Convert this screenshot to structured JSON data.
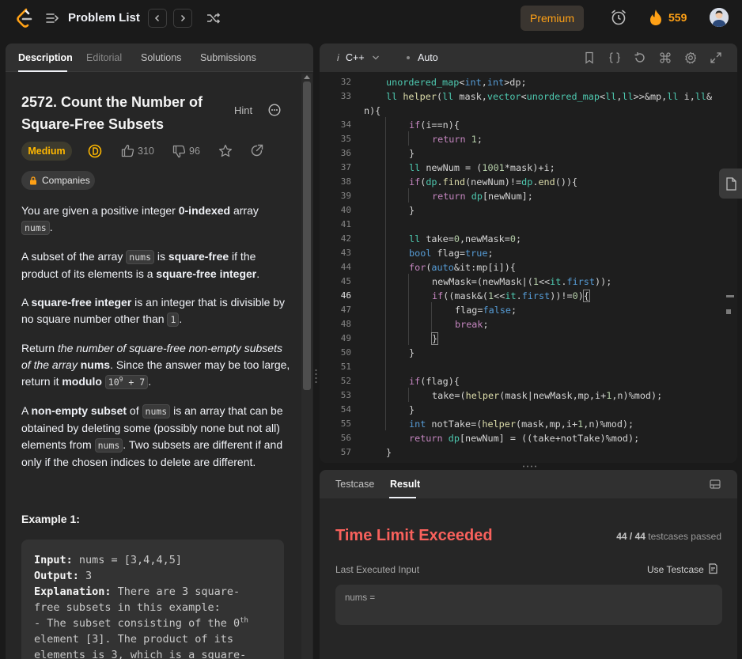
{
  "topbar": {
    "title": "Problem List",
    "premium": "Premium",
    "streak": "559"
  },
  "left_tabs": [
    "Description",
    "Editorial",
    "Solutions",
    "Submissions"
  ],
  "problem": {
    "title": "2572. Count the Number of Square-Free Subsets",
    "hint": "Hint",
    "difficulty": "Medium",
    "likes": "310",
    "dislikes": "96",
    "companies": "Companies",
    "example_title": "Example 1:",
    "example": {
      "input_label": "Input:",
      "input_value": " nums = [3,4,4,5]",
      "output_label": "Output:",
      "output_value": " 3",
      "explanation_label": "Explanation:",
      "explanation_1": " There are 3 square-",
      "explanation_2": "free subsets in this example:",
      "explanation_3": "- The subset consisting of the 0",
      "explanation_3_sup": "th",
      "explanation_4": "element [3]. The product of its",
      "explanation_5": "elements is 3, which is a square-"
    }
  },
  "editor": {
    "language": "C++",
    "mode": "Auto"
  },
  "result": {
    "tabs": [
      "Testcase",
      "Result"
    ],
    "status": "Time Limit Exceeded",
    "passed": "44 / 44",
    "passed_suffix": "testcases passed",
    "last_input_label": "Last Executed Input",
    "use_testcase": "Use Testcase",
    "input_label": "nums ="
  },
  "colors": {
    "accent": "#ffa116",
    "medium": "#ffb800",
    "error": "#f8615c"
  }
}
